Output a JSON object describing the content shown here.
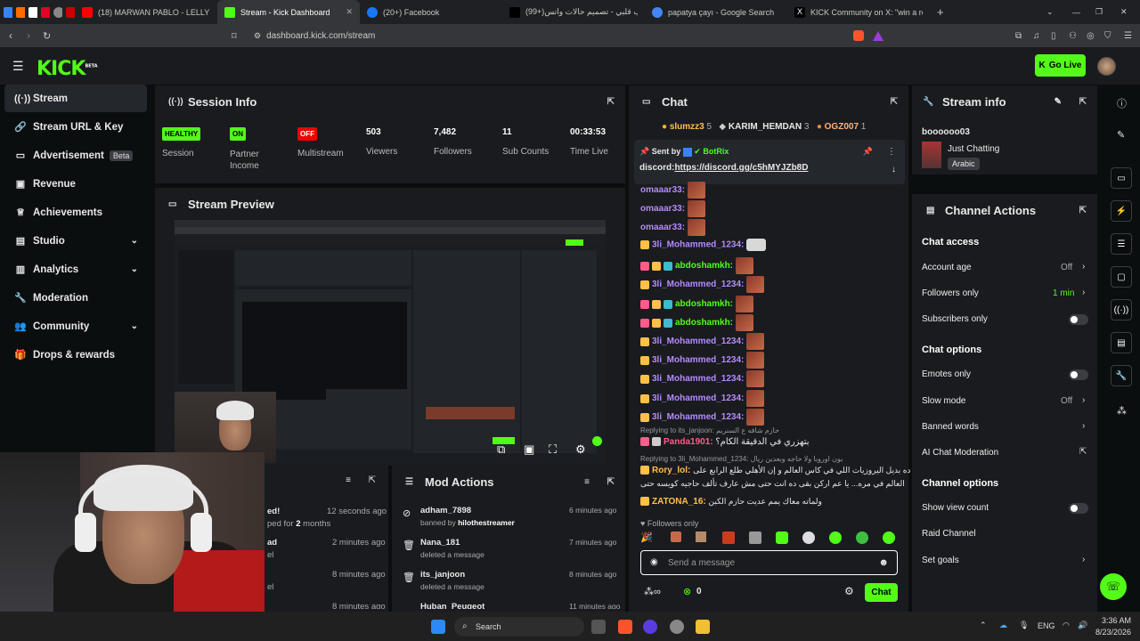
{
  "browser": {
    "tabs": [
      {
        "label": "(18) MARWAN PABLO - LELLY YAH [O...",
        "color": "#ff0000"
      },
      {
        "label": "Stream - Kick Dashboard",
        "color": "#53fc18",
        "active": true
      },
      {
        "label": "(20+) Facebook",
        "color": "#1877f2"
      },
      {
        "label": "(99+)حبيب قلبي - تصميم حالات واتس",
        "color": "#000000"
      },
      {
        "label": "papatya çayı - Google Search",
        "color": "#4285f4"
      },
      {
        "label": "KICK Community on X: \"win a round...",
        "color": "#000000"
      }
    ],
    "url": "dashboard.kick.com/stream"
  },
  "header": {
    "logo": "KICK",
    "logo_sup": "BETA",
    "go_live": "Go Live"
  },
  "sidebar": {
    "items": [
      {
        "label": "Stream",
        "icon": "broadcast-icon",
        "active": true
      },
      {
        "label": "Stream URL & Key",
        "icon": "link-icon"
      },
      {
        "label": "Advertisement",
        "icon": "monitor-icon",
        "badge": "Beta"
      },
      {
        "label": "Revenue",
        "icon": "card-icon"
      },
      {
        "label": "Achievements",
        "icon": "trophy-icon"
      },
      {
        "label": "Studio",
        "icon": "studio-icon",
        "chevron": true
      },
      {
        "label": "Analytics",
        "icon": "chart-icon",
        "chevron": true
      },
      {
        "label": "Moderation",
        "icon": "wrench-icon"
      },
      {
        "label": "Community",
        "icon": "people-icon",
        "chevron": true
      },
      {
        "label": "Drops & rewards",
        "icon": "gift-icon"
      }
    ]
  },
  "session": {
    "title": "Session Info",
    "healthy": "HEALTHY",
    "healthy_label": "Session",
    "partner": "ON",
    "partner_label": "Partner Income",
    "multistream": "OFF",
    "multistream_label": "Multistream",
    "viewers": "503",
    "viewers_label": "Viewers",
    "followers": "7,482",
    "followers_label": "Followers",
    "subs": "11",
    "subs_label": "Sub Counts",
    "time": "00:33:53",
    "time_label": "Time Live"
  },
  "preview": {
    "title": "Stream Preview"
  },
  "modactions": {
    "title": "Mod Actions",
    "rows": [
      {
        "user": "adham_7898",
        "action": "banned by hilothestreamer",
        "time": "6 minutes ago"
      },
      {
        "user": "Nana_181",
        "action": "deleted a message",
        "time": "7 minutes ago"
      },
      {
        "user": "its_janjoon",
        "action": "deleted a message",
        "time": "8 minutes ago"
      },
      {
        "user": "Huban_Peugeot",
        "action": "",
        "time": "11 minutes ago"
      }
    ]
  },
  "activity": {
    "rows": [
      {
        "a": "ed!",
        "b": "ped for 2 months",
        "time": "12 seconds ago"
      },
      {
        "a": "ad",
        "b": "el",
        "time": "2 minutes ago"
      },
      {
        "a": "",
        "b": "el",
        "time": "8 minutes ago"
      },
      {
        "a": "",
        "b": "",
        "time": "8 minutes ago"
      }
    ]
  },
  "chat": {
    "title": "Chat",
    "top": [
      {
        "name": "slumzz3",
        "n": "5"
      },
      {
        "name": "KARIM_HEMDAN",
        "n": "3"
      },
      {
        "name": "OGZ007",
        "n": "1"
      }
    ],
    "pin_sender": "Sent by",
    "pin_bot": "BotRix",
    "pin_text": "discord:",
    "pin_link": "https://discord.gg/c5hMYJZb8D",
    "messages": [
      {
        "u": "omaaar33:",
        "c": "purple"
      },
      {
        "u": "omaaar33:",
        "c": "purple"
      },
      {
        "u": "omaaar33:",
        "c": "purple"
      },
      {
        "u": "3li_Mohammed_1234:",
        "c": "purple"
      },
      {
        "u": "abdoshamkh:",
        "c": "greenmsg"
      },
      {
        "u": "3li_Mohammed_1234:",
        "c": "purple"
      },
      {
        "u": "abdoshamkh:",
        "c": "greenmsg"
      },
      {
        "u": "abdoshamkh:",
        "c": "greenmsg"
      },
      {
        "u": "3li_Mohammed_1234:",
        "c": "purple"
      },
      {
        "u": "3li_Mohammed_1234:",
        "c": "purple"
      },
      {
        "u": "3li_Mohammed_1234:",
        "c": "purple"
      },
      {
        "u": "3li_Mohammed_1234:",
        "c": "purple"
      },
      {
        "u": "3li_Mohammed_1234:",
        "c": "purple"
      }
    ],
    "reply1": "Replying to its_janjoon: حازم شافه ع السنريم",
    "reply1_user": "Panda1901:",
    "reply1_text": "بتهزري في الدقيقة الكام؟",
    "reply2": "Replying to 3li_Mohammed_1234: بون اوروبا ولا حاجه وبعدين ريال",
    "reply2_user": "Rory_lol:",
    "reply2_text": "مسح ده بديل اليروزيات اللي في كاس العالم و إن الأهلي طلع الرابع على",
    "reply2_text2": "العالم في مره... يا عم اركن بقى ده انت حتى مش عارف تألف حاجيه كويسه حتى",
    "last_user": "ZATONA_16:",
    "last_text": "ولماته معاك يمم عديت حازم الكبن",
    "followers_only": "Followers only",
    "placeholder": "Send a message",
    "count": "0",
    "send": "Chat"
  },
  "streaminfo": {
    "title": "Stream info",
    "name": "boooooo03",
    "category": "Just Chatting",
    "lang": "Arabic"
  },
  "actions": {
    "title": "Channel Actions",
    "chat_access": "Chat access",
    "account_age": "Account age",
    "account_age_val": "Off",
    "followers_only": "Followers only",
    "followers_only_val": "1 min",
    "subs_only": "Subscribers only",
    "chat_options": "Chat options",
    "emotes_only": "Emotes only",
    "slow_mode": "Slow mode",
    "slow_mode_val": "Off",
    "banned_words": "Banned words",
    "ai_mod": "AI Chat Moderation",
    "channel_options": "Channel options",
    "viewcount": "Show view count",
    "raid": "Raid Channel",
    "goals": "Set goals"
  },
  "taskbar": {
    "search": "Search",
    "lang": "ENG",
    "time": "3:36 AM",
    "date": "8/23/2026"
  }
}
